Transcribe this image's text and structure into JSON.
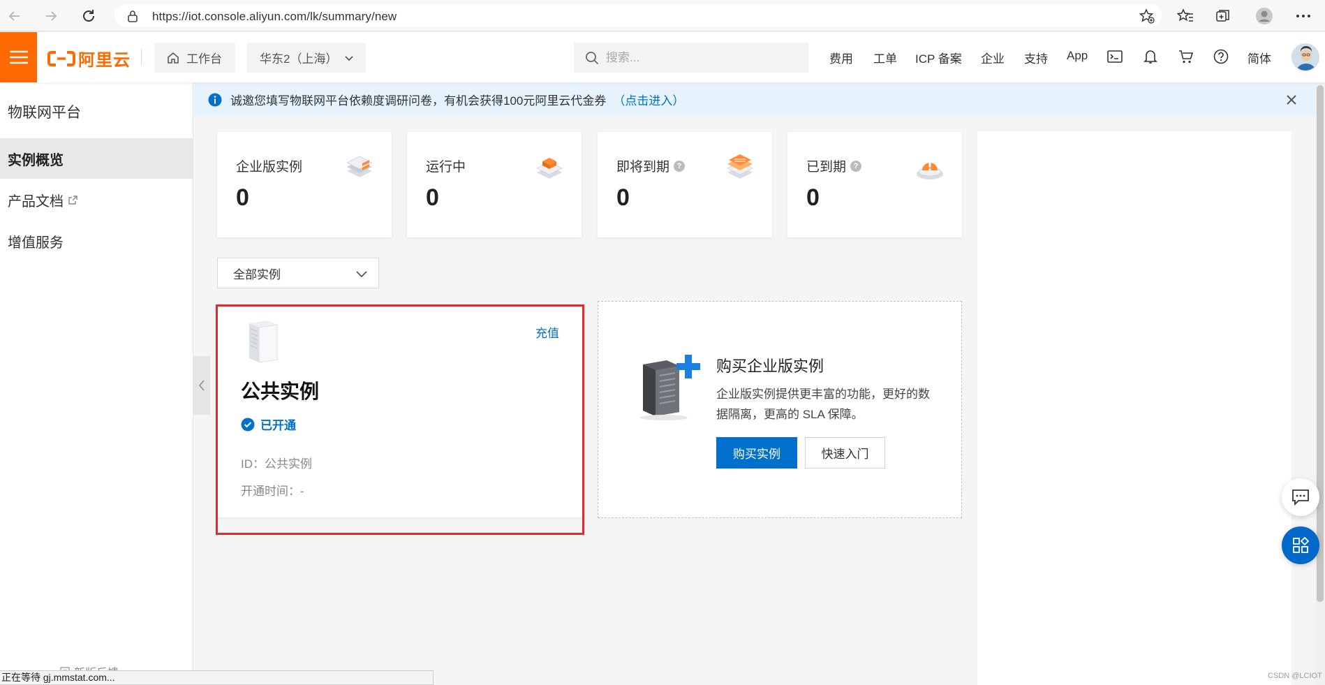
{
  "browser": {
    "url": "https://iot.console.aliyun.com/lk/summary/new"
  },
  "header": {
    "logo_text": "阿里云",
    "workbench_label": "工作台",
    "region_label": "华东2（上海）",
    "search_placeholder": "搜索...",
    "links": [
      "费用",
      "工单",
      "ICP 备案",
      "企业",
      "支持",
      "App"
    ],
    "lang_label": "简体",
    "accent_color": "#ff6a00"
  },
  "sidebar": {
    "title": "物联网平台",
    "items": [
      {
        "label": "实例概览",
        "active": true
      },
      {
        "label": "产品文档",
        "external": true
      },
      {
        "label": "增值服务"
      }
    ],
    "feedback_label": "新版反馈"
  },
  "notice": {
    "text": "诚邀您填写物联网平台依赖度调研问卷，有机会获得100元阿里云代金券",
    "link": "（点击进入）"
  },
  "stats": [
    {
      "label": "企业版实例",
      "value": "0",
      "icon": "enterprise-stack-icon"
    },
    {
      "label": "运行中",
      "value": "0",
      "icon": "running-stack-icon"
    },
    {
      "label": "即将到期",
      "value": "0",
      "icon": "expiring-stack-icon",
      "help": "?"
    },
    {
      "label": "已到期",
      "value": "0",
      "icon": "expired-alert-icon",
      "help": "?"
    }
  ],
  "filter": {
    "selected": "全部实例"
  },
  "public_instance": {
    "action": "充值",
    "title": "公共实例",
    "status": "已开通",
    "id_label": "ID：公共实例",
    "opened_label": "开通时间：-"
  },
  "buy_card": {
    "title": "购买企业版实例",
    "desc": "企业版实例提供更丰富的功能，更好的数据隔离，更高的 SLA 保障。",
    "primary_button": "购买实例",
    "secondary_button": "快速入门"
  },
  "status_bar": {
    "text": "正在等待 gj.mmstat.com..."
  },
  "watermark": "CSDN @LCIOT",
  "colors": {
    "primary": "#0070cc",
    "brand": "#ff6a00",
    "highlight": "#e32b2b"
  }
}
